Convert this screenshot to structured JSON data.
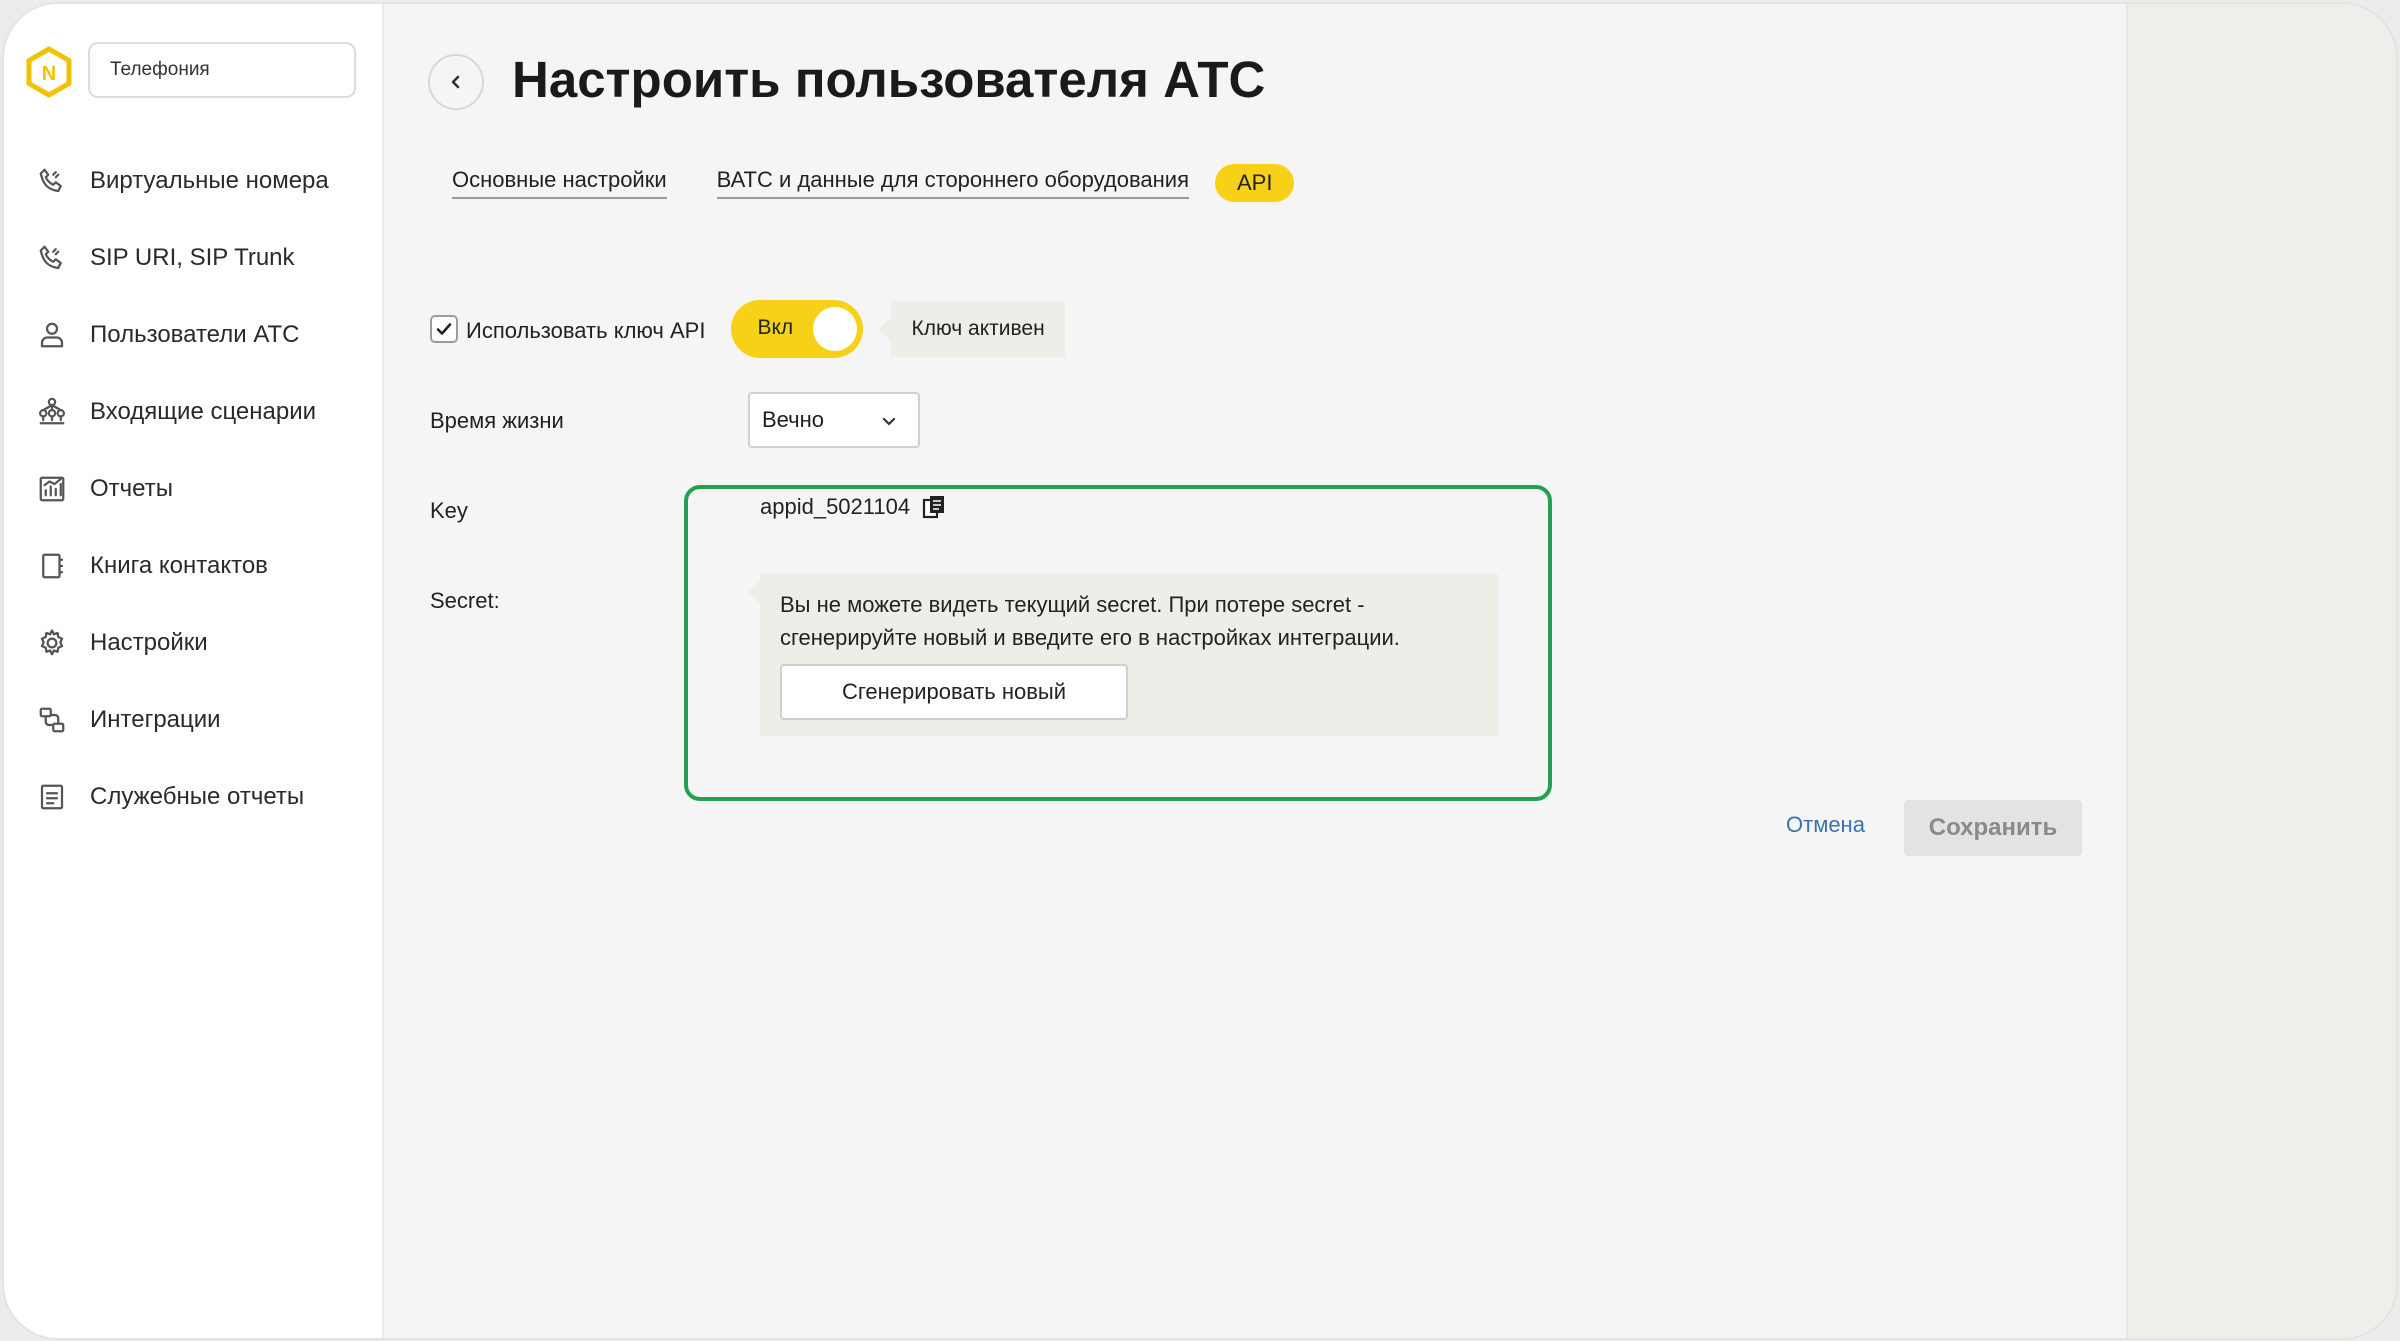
{
  "sidebar": {
    "product_select": "Телефония",
    "items": [
      {
        "label": "Виртуальные номера",
        "icon": "phone-icon"
      },
      {
        "label": "SIP URI, SIP Trunk",
        "icon": "phone-icon"
      },
      {
        "label": "Пользователи АТС",
        "icon": "user-icon"
      },
      {
        "label": "Входящие сценарии",
        "icon": "hierarchy-icon"
      },
      {
        "label": "Отчеты",
        "icon": "chart-icon"
      },
      {
        "label": "Книга контактов",
        "icon": "contact-book-icon"
      },
      {
        "label": "Настройки",
        "icon": "gear-icon"
      },
      {
        "label": "Интеграции",
        "icon": "integration-icon"
      },
      {
        "label": "Служебные отчеты",
        "icon": "document-icon"
      }
    ]
  },
  "header": {
    "title": "Настроить пользователя АТС"
  },
  "tabs": [
    {
      "label": "Основные настройки",
      "active": false
    },
    {
      "label": "ВАТС и данные для стороннего оборудования",
      "active": false
    },
    {
      "label": "API",
      "active": true
    }
  ],
  "api": {
    "use_key_label": "Использовать ключ API",
    "use_key_checked": true,
    "toggle_label": "Вкл",
    "toggle_on": true,
    "status": "Ключ активен"
  },
  "lifetime": {
    "label": "Время жизни",
    "value": "Вечно"
  },
  "key": {
    "label": "Key",
    "value": "appid_5021104"
  },
  "secret": {
    "label": "Secret:",
    "notice": "Вы не можете видеть текущий secret. При потере secret - сгенерируйте новый и введите его в настройках интеграции.",
    "generate_label": "Сгенерировать новый"
  },
  "actions": {
    "cancel_label": "Отмена",
    "save_label": "Сохранить"
  },
  "colors": {
    "accent": "#f7d117",
    "highlight_border": "#23a14e",
    "link": "#3b73b0"
  }
}
